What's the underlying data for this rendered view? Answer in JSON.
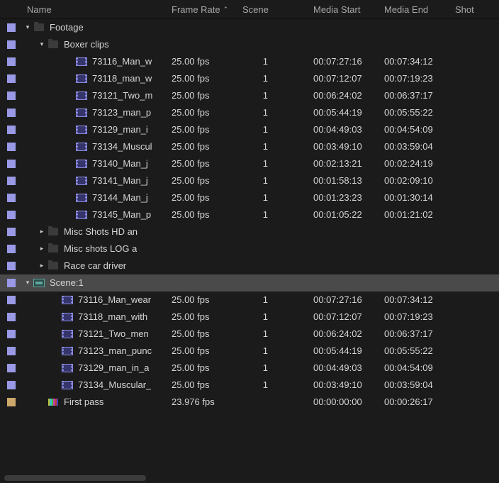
{
  "columns": {
    "name": "Name",
    "frameRate": "Frame Rate",
    "scene": "Scene",
    "mediaStart": "Media Start",
    "mediaEnd": "Media End",
    "shot": "Shot"
  },
  "sort": {
    "column": "frameRate",
    "dir": "asc",
    "caret": "⌃"
  },
  "rows": [
    {
      "swatch": "lilac",
      "indent": 0,
      "twisty": "down",
      "icon": "folder",
      "name": "Footage",
      "interact": true
    },
    {
      "swatch": "lilac",
      "indent": 1,
      "twisty": "down",
      "icon": "folder",
      "name": "Boxer clips",
      "interact": true
    },
    {
      "swatch": "lilac",
      "indent": 3,
      "icon": "clip",
      "name": "73116_Man_w",
      "fr": "25.00 fps",
      "scene": "1",
      "ms": "00:07:27:16",
      "me": "00:07:34:12",
      "interact": true
    },
    {
      "swatch": "lilac",
      "indent": 3,
      "icon": "clip",
      "name": "73118_man_w",
      "fr": "25.00 fps",
      "scene": "1",
      "ms": "00:07:12:07",
      "me": "00:07:19:23",
      "interact": true
    },
    {
      "swatch": "lilac",
      "indent": 3,
      "icon": "clip",
      "name": "73121_Two_m",
      "fr": "25.00 fps",
      "scene": "1",
      "ms": "00:06:24:02",
      "me": "00:06:37:17",
      "interact": true
    },
    {
      "swatch": "lilac",
      "indent": 3,
      "icon": "clip",
      "name": "73123_man_p",
      "fr": "25.00 fps",
      "scene": "1",
      "ms": "00:05:44:19",
      "me": "00:05:55:22",
      "interact": true
    },
    {
      "swatch": "lilac",
      "indent": 3,
      "icon": "clip",
      "name": "73129_man_i",
      "fr": "25.00 fps",
      "scene": "1",
      "ms": "00:04:49:03",
      "me": "00:04:54:09",
      "interact": true
    },
    {
      "swatch": "lilac",
      "indent": 3,
      "icon": "clip",
      "name": "73134_Muscul",
      "fr": "25.00 fps",
      "scene": "1",
      "ms": "00:03:49:10",
      "me": "00:03:59:04",
      "interact": true
    },
    {
      "swatch": "lilac",
      "indent": 3,
      "icon": "clip",
      "name": "73140_Man_j",
      "fr": "25.00 fps",
      "scene": "1",
      "ms": "00:02:13:21",
      "me": "00:02:24:19",
      "interact": true
    },
    {
      "swatch": "lilac",
      "indent": 3,
      "icon": "clip",
      "name": "73141_Man_j",
      "fr": "25.00 fps",
      "scene": "1",
      "ms": "00:01:58:13",
      "me": "00:02:09:10",
      "interact": true
    },
    {
      "swatch": "lilac",
      "indent": 3,
      "icon": "clip",
      "name": "73144_Man_j",
      "fr": "25.00 fps",
      "scene": "1",
      "ms": "00:01:23:23",
      "me": "00:01:30:14",
      "interact": true
    },
    {
      "swatch": "lilac",
      "indent": 3,
      "icon": "clip",
      "name": "73145_Man_p",
      "fr": "25.00 fps",
      "scene": "1",
      "ms": "00:01:05:22",
      "me": "00:01:21:02",
      "interact": true
    },
    {
      "swatch": "lilac",
      "indent": 1,
      "twisty": "right",
      "icon": "folder",
      "name": "Misc Shots HD an",
      "interact": true
    },
    {
      "swatch": "lilac",
      "indent": 1,
      "twisty": "right",
      "icon": "folder",
      "name": "Misc shots LOG a",
      "interact": true
    },
    {
      "swatch": "lilac",
      "indent": 1,
      "twisty": "right",
      "icon": "folder",
      "name": "Race car driver",
      "interact": true
    },
    {
      "swatch": "lilac",
      "indent": 0,
      "twisty": "down",
      "icon": "seq",
      "name": "Scene:1",
      "interact": true,
      "selected": true
    },
    {
      "swatch": "lilac",
      "indent": 2,
      "icon": "clip",
      "name": "73116_Man_wear",
      "fr": "25.00 fps",
      "scene": "1",
      "ms": "00:07:27:16",
      "me": "00:07:34:12",
      "interact": true
    },
    {
      "swatch": "lilac",
      "indent": 2,
      "icon": "clip",
      "name": "73118_man_with",
      "fr": "25.00 fps",
      "scene": "1",
      "ms": "00:07:12:07",
      "me": "00:07:19:23",
      "interact": true
    },
    {
      "swatch": "lilac",
      "indent": 2,
      "icon": "clip",
      "name": "73121_Two_men",
      "fr": "25.00 fps",
      "scene": "1",
      "ms": "00:06:24:02",
      "me": "00:06:37:17",
      "interact": true
    },
    {
      "swatch": "lilac",
      "indent": 2,
      "icon": "clip",
      "name": "73123_man_punc",
      "fr": "25.00 fps",
      "scene": "1",
      "ms": "00:05:44:19",
      "me": "00:05:55:22",
      "interact": true
    },
    {
      "swatch": "lilac",
      "indent": 2,
      "icon": "clip",
      "name": "73129_man_in_a",
      "fr": "25.00 fps",
      "scene": "1",
      "ms": "00:04:49:03",
      "me": "00:04:54:09",
      "interact": true
    },
    {
      "swatch": "lilac",
      "indent": 2,
      "icon": "clip",
      "name": "73134_Muscular_",
      "fr": "25.00 fps",
      "scene": "1",
      "ms": "00:03:49:10",
      "me": "00:03:59:04",
      "interact": true
    },
    {
      "swatch": "gold",
      "indent": 1,
      "icon": "bars",
      "name": "First pass",
      "fr": "23.976 fps",
      "ms": "00:00:00:00",
      "me": "00:00:26:17",
      "interact": true
    }
  ]
}
